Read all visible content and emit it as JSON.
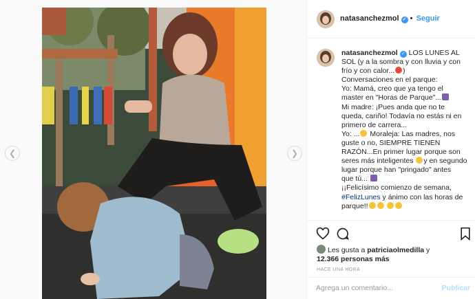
{
  "post": {
    "username": "natasanchezmol",
    "follow_label": "Seguir",
    "verified_icon": "verified-badge-icon"
  },
  "caption": {
    "username": "natasanchezmol",
    "lines": [
      "LOS LUNES AL",
      "SOL (y a la sombra y con lluvia y con",
      "frío y con calor...",
      "Conversaciones en el parque:",
      "Yo: Mamá, creo que ya tengo el",
      "master en \"Horas de Parque\"...",
      "Mi madre: ¡Pues anda que no te",
      "queda, cariño! Todavía no estás ni en",
      "primero de carrera...",
      "Yo: ...",
      "Moraleja: Las madres, nos",
      "guste o no, SIEMPRE TIENEN",
      "RAZÓN...En primer lugar porque son",
      "seres más inteligentes",
      "y en segundo",
      "lugar porque han \"pringado\" antes",
      "que tú...",
      "¡¡Felicísimo comienzo de semana,",
      "#FelizLunes",
      "y ánimo con las horas de",
      "parque!!"
    ]
  },
  "likes": {
    "prefix": "Les gusta a",
    "user": "patriciaolmedilla",
    "joiner": "y",
    "count": "12.366 personas más"
  },
  "timestamp": "HACE UNA HORA",
  "comment": {
    "placeholder": "Agrega un comentario...",
    "publish_label": "Publicar"
  },
  "colors": {
    "accent": "#3897f0",
    "hashtag": "#003569",
    "publish_disabled": "#b2dffc"
  }
}
